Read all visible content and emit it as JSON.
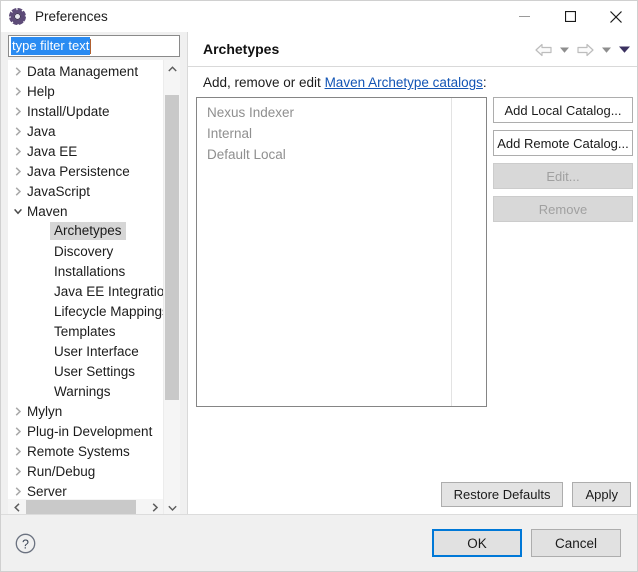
{
  "window": {
    "title": "Preferences",
    "icon": "preferences-gear-icon",
    "controls": {
      "minimize": "minimize-icon",
      "maximize": "maximize-icon",
      "close": "close-icon"
    }
  },
  "filter": {
    "value": "type filter text",
    "placeholder": "type filter text",
    "selected": true
  },
  "tree": {
    "items": [
      {
        "label": "Data Management",
        "level": 0,
        "expandable": true,
        "expanded": false,
        "selected": false
      },
      {
        "label": "Help",
        "level": 0,
        "expandable": true,
        "expanded": false,
        "selected": false
      },
      {
        "label": "Install/Update",
        "level": 0,
        "expandable": true,
        "expanded": false,
        "selected": false
      },
      {
        "label": "Java",
        "level": 0,
        "expandable": true,
        "expanded": false,
        "selected": false
      },
      {
        "label": "Java EE",
        "level": 0,
        "expandable": true,
        "expanded": false,
        "selected": false
      },
      {
        "label": "Java Persistence",
        "level": 0,
        "expandable": true,
        "expanded": false,
        "selected": false
      },
      {
        "label": "JavaScript",
        "level": 0,
        "expandable": true,
        "expanded": false,
        "selected": false
      },
      {
        "label": "Maven",
        "level": 0,
        "expandable": true,
        "expanded": true,
        "selected": false
      },
      {
        "label": "Archetypes",
        "level": 1,
        "expandable": false,
        "expanded": false,
        "selected": true
      },
      {
        "label": "Discovery",
        "level": 1,
        "expandable": false,
        "expanded": false,
        "selected": false
      },
      {
        "label": "Installations",
        "level": 1,
        "expandable": false,
        "expanded": false,
        "selected": false
      },
      {
        "label": "Java EE Integration",
        "level": 1,
        "expandable": false,
        "expanded": false,
        "selected": false
      },
      {
        "label": "Lifecycle Mappings",
        "level": 1,
        "expandable": false,
        "expanded": false,
        "selected": false
      },
      {
        "label": "Templates",
        "level": 1,
        "expandable": false,
        "expanded": false,
        "selected": false
      },
      {
        "label": "User Interface",
        "level": 1,
        "expandable": false,
        "expanded": false,
        "selected": false
      },
      {
        "label": "User Settings",
        "level": 1,
        "expandable": false,
        "expanded": false,
        "selected": false
      },
      {
        "label": "Warnings",
        "level": 1,
        "expandable": false,
        "expanded": false,
        "selected": false
      },
      {
        "label": "Mylyn",
        "level": 0,
        "expandable": true,
        "expanded": false,
        "selected": false
      },
      {
        "label": "Plug-in Development",
        "level": 0,
        "expandable": true,
        "expanded": false,
        "selected": false
      },
      {
        "label": "Remote Systems",
        "level": 0,
        "expandable": true,
        "expanded": false,
        "selected": false
      },
      {
        "label": "Run/Debug",
        "level": 0,
        "expandable": true,
        "expanded": false,
        "selected": false
      },
      {
        "label": "Server",
        "level": 0,
        "expandable": true,
        "expanded": false,
        "selected": false
      }
    ],
    "scrollbars": {
      "vertical": "tree-vertical-scrollbar",
      "horizontal": "tree-horizontal-scrollbar"
    }
  },
  "page": {
    "title": "Archetypes",
    "nav": {
      "back": "back-arrow-icon",
      "back_menu": "back-dropdown-icon",
      "forward": "forward-arrow-icon",
      "forward_menu": "forward-dropdown-icon",
      "view_menu": "view-menu-chevron-icon"
    },
    "description": {
      "prefix": "Add, remove or edit ",
      "link": "Maven Archetype catalogs",
      "suffix": ":"
    },
    "catalogs": [
      "Nexus Indexer",
      "Internal",
      "Default Local"
    ],
    "side_buttons": [
      {
        "label": "Add Local Catalog...",
        "enabled": true
      },
      {
        "label": "Add Remote Catalog...",
        "enabled": true
      },
      {
        "label": "Edit...",
        "enabled": false
      },
      {
        "label": "Remove",
        "enabled": false
      }
    ],
    "footer_buttons": [
      {
        "label": "Restore Defaults"
      },
      {
        "label": "Apply"
      }
    ]
  },
  "bottom": {
    "help": "help-question-icon",
    "ok": "OK",
    "cancel": "Cancel"
  },
  "colors": {
    "accent": "#0078d7",
    "selection": "#2a8bf2",
    "link": "#1355b5",
    "tree_selection": "#d6d6d6",
    "disabled_text": "#a0a0a0"
  }
}
